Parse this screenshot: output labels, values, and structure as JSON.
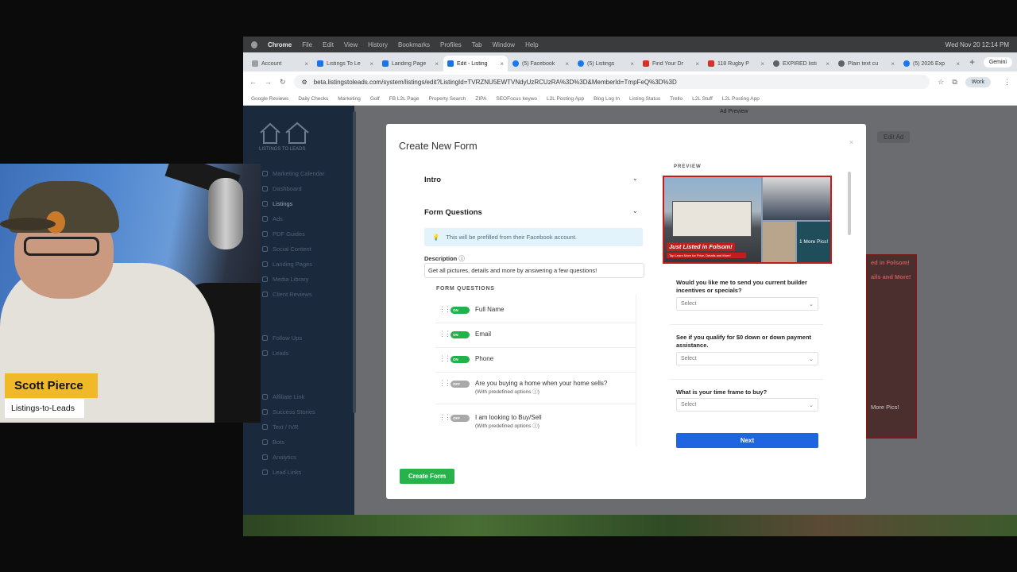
{
  "browser": {
    "menubar": {
      "app": "Chrome",
      "items": [
        "File",
        "Edit",
        "View",
        "History",
        "Bookmarks",
        "Profiles",
        "Tab",
        "Window",
        "Help"
      ],
      "clock": "Wed Nov 20  12:14 PM"
    },
    "tabs": [
      {
        "label": "Account",
        "color": "#9aa0a6"
      },
      {
        "label": "Listings To Le",
        "color": "#1a73e8"
      },
      {
        "label": "Landing Page",
        "color": "#1a73e8"
      },
      {
        "label": "Edit - Listing",
        "color": "#1a73e8"
      },
      {
        "label": "(5) Facebook",
        "color": "#1877f2"
      },
      {
        "label": "(5) Listings",
        "color": "#1877f2"
      },
      {
        "label": "Find Your Dr",
        "color": "#d93025"
      },
      {
        "label": "118 Rugby P",
        "color": "#d93025"
      },
      {
        "label": "EXPIRED listi",
        "color": "#5f6368"
      },
      {
        "label": "Plain text cu",
        "color": "#5f6368"
      },
      {
        "label": "(5) 2026 Exp",
        "color": "#1877f2"
      }
    ],
    "gemini_label": "Gemini",
    "url": "beta.listingstoleads.com/system/listings/edit?ListingId=TVRZNU5EWTVNdyUzRCUzRA%3D%3D&MemberId=TmpFeQ%3D%3D",
    "profile_label": "Work",
    "bookmarks": [
      "Google Reviews",
      "Daily Checks",
      "Marketing",
      "Golf",
      "FB L2L Page",
      "Property Search",
      "ZIPA",
      "SEOFocus keywo",
      "L2L Posting App",
      "Blog Log In",
      "Listing Status",
      "Trello",
      "L2L Stuff",
      "L2L Posting App"
    ]
  },
  "sidebar": {
    "logo_text": "LISTINGS TO LEADS",
    "items": [
      {
        "label": "Marketing Calendar"
      },
      {
        "label": "Dashboard"
      },
      {
        "label": "Listings"
      },
      {
        "label": "Ads"
      },
      {
        "label": "PDF Guides"
      },
      {
        "label": "Social Content"
      },
      {
        "label": "Landing Pages"
      },
      {
        "label": "Media Library"
      },
      {
        "label": "Client Reviews"
      },
      {
        "label": "Follow Ups"
      },
      {
        "label": "Leads"
      },
      {
        "label": "Affiliate Link"
      },
      {
        "label": "Success Stories"
      },
      {
        "label": "Text / IVR"
      },
      {
        "label": "Bots"
      },
      {
        "label": "Analytics"
      },
      {
        "label": "Lead Links"
      }
    ]
  },
  "background": {
    "ad_preview_label": "Ad Preview",
    "edit_ad_label": "Edit Ad",
    "panel_text_1": "ed in Folsom!",
    "panel_text_2": "ails and More!",
    "panel_text_3": "More Pics!"
  },
  "modal": {
    "title": "Create New Form",
    "close": "×",
    "intro_label": "Intro",
    "form_questions_label": "Form Questions",
    "info_text": "This will be prefilled from their Facebook account.",
    "description_label": "Description",
    "description_value": "Get all pictures, details and more by answering a few questions!",
    "questions_header": "FORM QUESTIONS",
    "questions": [
      {
        "label": "Full Name",
        "toggle": "ON",
        "sub": ""
      },
      {
        "label": "Email",
        "toggle": "ON",
        "sub": ""
      },
      {
        "label": "Phone",
        "toggle": "ON",
        "sub": ""
      },
      {
        "label": "Are you buying a home when your home sells?",
        "toggle": "OFF",
        "sub": "(With predefined options"
      },
      {
        "label": "I am looking to Buy/Sell",
        "toggle": "OFF",
        "sub": "(With predefined options"
      }
    ],
    "create_button": "Create Form",
    "preview": {
      "label": "PREVIEW",
      "badge": "Just Listed in Folsom!",
      "badge_sub": "Tap Learn More for Price, Details and More!",
      "more_pics": "1 More Pics!",
      "questions": [
        {
          "label": "Would you like me to send you current builder incentives or specials?",
          "select": "Select"
        },
        {
          "label": "See if you qualify for $0 down or down payment assistance.",
          "select": "Select"
        },
        {
          "label": "What is your time frame to buy?",
          "select": "Select"
        }
      ],
      "next_button": "Next"
    }
  },
  "webcam": {
    "name": "Scott Pierce",
    "company": "Listings-to-Leads"
  }
}
